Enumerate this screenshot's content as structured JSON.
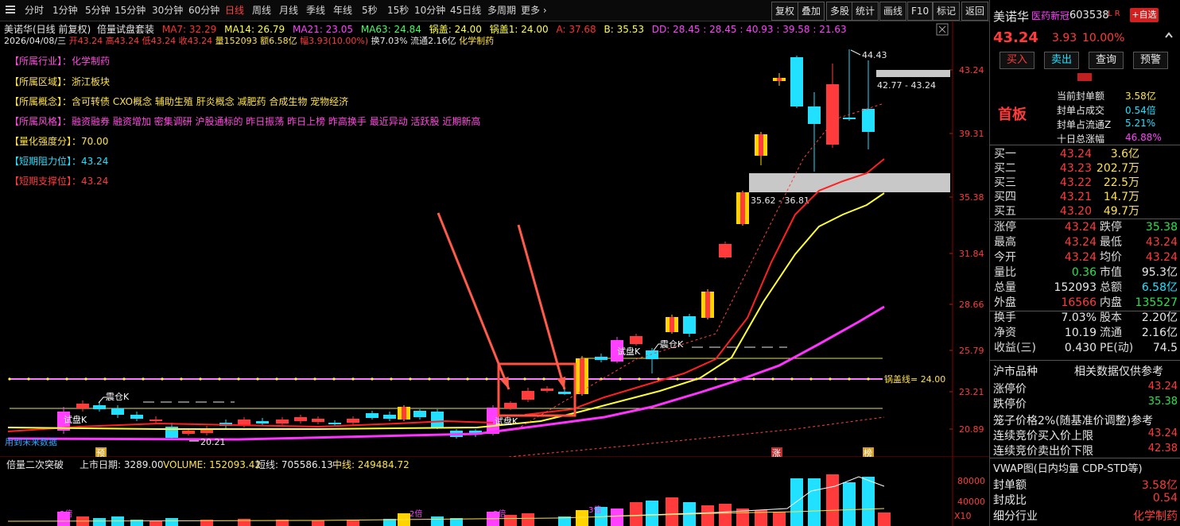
{
  "toolbar": {
    "periods": [
      "分时",
      "1分钟",
      "5分钟",
      "15分钟",
      "30分钟",
      "60分钟",
      "日线",
      "周线",
      "月线",
      "季线",
      "年线",
      "5秒",
      "15秒",
      "10分钟",
      "45日线",
      "多周期",
      "更多 ›"
    ],
    "active_period": "日线",
    "right_buttons": [
      "复权",
      "叠加",
      "多股",
      "统计",
      "画线",
      "F10",
      "标记",
      "返回"
    ]
  },
  "header": {
    "title": "美诺华(日线 前复权)",
    "indicator": "倍量试盘套装",
    "ma7": "MA7: 32.29",
    "ma14": "MA14: 26.79",
    "ma21": "MA21: 23.05",
    "ma63": "MA63: 24.84",
    "guogai": "锅盖: 24.00",
    "guogai1": "锅盖1: 24.00",
    "a": "A: 37.68",
    "b": "B: 35.53",
    "dd": "DD: 28.45 : 28.45 : 40.93 : 39.58 : 21.63",
    "date": "2026/04/08/三",
    "open": "开43.24",
    "high": "高43.24",
    "low": "低43.24",
    "close": "收43.24",
    "volume": "量152093",
    "amount": "额6.58亿",
    "amplitude": "幅3.93(10.00%)",
    "turnover": "换7.03%",
    "float_cap": "流通2.16亿",
    "sector": "化学制药"
  },
  "fundamentals": [
    {
      "label": "【所属行业】：",
      "value": "化学制药",
      "label_color": "#ff4ae0",
      "value_color": "#ff4ae0"
    },
    {
      "label": "【所属区域】：",
      "value": "浙江板块",
      "label_color": "#ffe24a",
      "value_color": "#ffe24a"
    },
    {
      "label": "【所属概念】：",
      "value": "含可转债 CXO概念 辅助生殖 肝炎概念 减肥药 合成生物 宠物经济",
      "label_color": "#ffe24a",
      "value_color": "#ffe24a"
    },
    {
      "label": "【所属风格】：",
      "value": "融资融券 融资增加 密集调研 沪股通标的 昨日振荡 昨日上榜 昨高换手 最近异动 活跃股 近期新高",
      "label_color": "#ff4ae0",
      "value_color": "#ff4ae0"
    },
    {
      "label": "【量化强度分】：",
      "value": "70.00",
      "label_color": "#ffe24a",
      "value_color": "#ffe24a"
    },
    {
      "label": "【短期阻力位】：",
      "value": "43.24",
      "label_color": "#22e0ff",
      "value_color": "#22e0ff"
    },
    {
      "label": "【短期支撑位】：",
      "value": "43.24",
      "label_color": "#ff3b3b",
      "value_color": "#ff3b3b"
    }
  ],
  "chart_annotations": {
    "peak_label": "44.43",
    "upper_zone": "42.77 - 43.24",
    "lower_zone": "35.62 - 36.81",
    "lid_line": "锅盖线= 24.00",
    "low_label": "20.21",
    "trial_k_1": "试盘K",
    "trial_k_2": "试盘K",
    "trial_k_3": "试盘K",
    "shock_k_1": "震仓K",
    "shock_k_2": "震仓K",
    "future_data": "用到未来数据",
    "marker_yu": "预",
    "marker_zhang": "涨",
    "marker_bang": "榜"
  },
  "price_axis": [
    "43.24",
    "39.31",
    "35.38",
    "31.84",
    "28.66",
    "25.79",
    "23.21",
    "20.89"
  ],
  "volume_panel": {
    "title": "倍量二次突破",
    "listing_date": "上市日期: 3289.00",
    "volume": "VOLUME: 152093.42",
    "short_line": "短线: 705586.13",
    "mid_line": "中线: 249484.72",
    "axis": [
      "80000",
      "40000"
    ],
    "unit": "X10",
    "double_marks": [
      "3倍",
      "2倍",
      "3倍",
      "3倍"
    ]
  },
  "quote": {
    "name": "美诺华",
    "tag": "医药新冠",
    "code": "603538",
    "flags": "L R",
    "add_button": "+自选",
    "price": "43.24",
    "change": "3.93",
    "change_pct": "10.00%",
    "buy_btn": "买入",
    "sell_btn": "卖出",
    "query_btn": "查询",
    "alert_btn": "预警",
    "board": "首板",
    "seal_amount_label": "当前封单额",
    "seal_amount": "3.58亿",
    "seal_ratio_label": "封单占成交",
    "seal_ratio": "0.54倍",
    "seal_float_label": "封单占流通Z",
    "seal_float": "5.21%",
    "ten_day_label": "十日总涨幅",
    "ten_day": "46.88%"
  },
  "order_book": [
    {
      "label": "买一",
      "price": "43.24",
      "vol": "3.6亿"
    },
    {
      "label": "买二",
      "price": "43.23",
      "vol": "202.7万"
    },
    {
      "label": "买三",
      "price": "43.22",
      "vol": "22.5万"
    },
    {
      "label": "买四",
      "price": "43.21",
      "vol": "14.7万"
    },
    {
      "label": "买五",
      "price": "43.20",
      "vol": "49.7万"
    }
  ],
  "stats": [
    {
      "l1": "涨停",
      "v1": "43.24",
      "c1": "red",
      "l2": "跌停",
      "v2": "35.38",
      "c2": "grn"
    },
    {
      "l1": "最高",
      "v1": "43.24",
      "c1": "red",
      "l2": "最低",
      "v2": "43.24",
      "c2": "red"
    },
    {
      "l1": "今开",
      "v1": "43.24",
      "c1": "red",
      "l2": "均价",
      "v2": "43.24",
      "c2": "red"
    },
    {
      "l1": "量比",
      "v1": "0.36",
      "c1": "grn",
      "l2": "市值",
      "v2": "95.3亿",
      "c2": "wht"
    },
    {
      "l1": "总量",
      "v1": "152093",
      "c1": "wht",
      "l2": "总额",
      "v2": "6.58亿",
      "c2": "cyan"
    },
    {
      "l1": "外盘",
      "v1": "16566",
      "c1": "red",
      "l2": "内盘",
      "v2": "135527",
      "c2": "grn"
    },
    {
      "l1": "换手",
      "v1": "7.03%",
      "c1": "wht",
      "l2": "股本",
      "v2": "2.20亿",
      "c2": "wht"
    },
    {
      "l1": "净资",
      "v1": "10.19",
      "c1": "wht",
      "l2": "流通",
      "v2": "2.16亿",
      "c2": "wht"
    },
    {
      "l1": "收益(三)",
      "v1": "0.430",
      "c1": "wht",
      "l2": "PE(动)",
      "v2": "74.5",
      "c2": "wht"
    }
  ],
  "market_section": {
    "title": "沪市品种",
    "note": "相关数据仅供参考",
    "limit_up_label": "涨停价",
    "limit_up": "43.24",
    "limit_down_label": "跌停价",
    "limit_down": "35.38",
    "cage_label": "笼子价格2%(随基准价调整)参考",
    "auction_buy_label": "连续竞价买入价上限",
    "auction_buy": "43.24",
    "auction_sell_label": "连续竞价卖出价下限",
    "auction_sell": "42.38",
    "vwap_label": "VWAP图(日内均量 CDP-STD等)",
    "seal_amt_label": "封单额",
    "seal_amt": "3.58亿",
    "seal_ratio_label": "封成比",
    "seal_ratio": "0.54",
    "industry_label": "细分行业",
    "industry": "化学制药"
  },
  "colors": {
    "up": "#ff3b3b",
    "down": "#22e0ff",
    "ma7": "#ff2020",
    "ma14": "#ffff33",
    "ma63": "#ff33ff",
    "lid": "#ff66ff"
  }
}
